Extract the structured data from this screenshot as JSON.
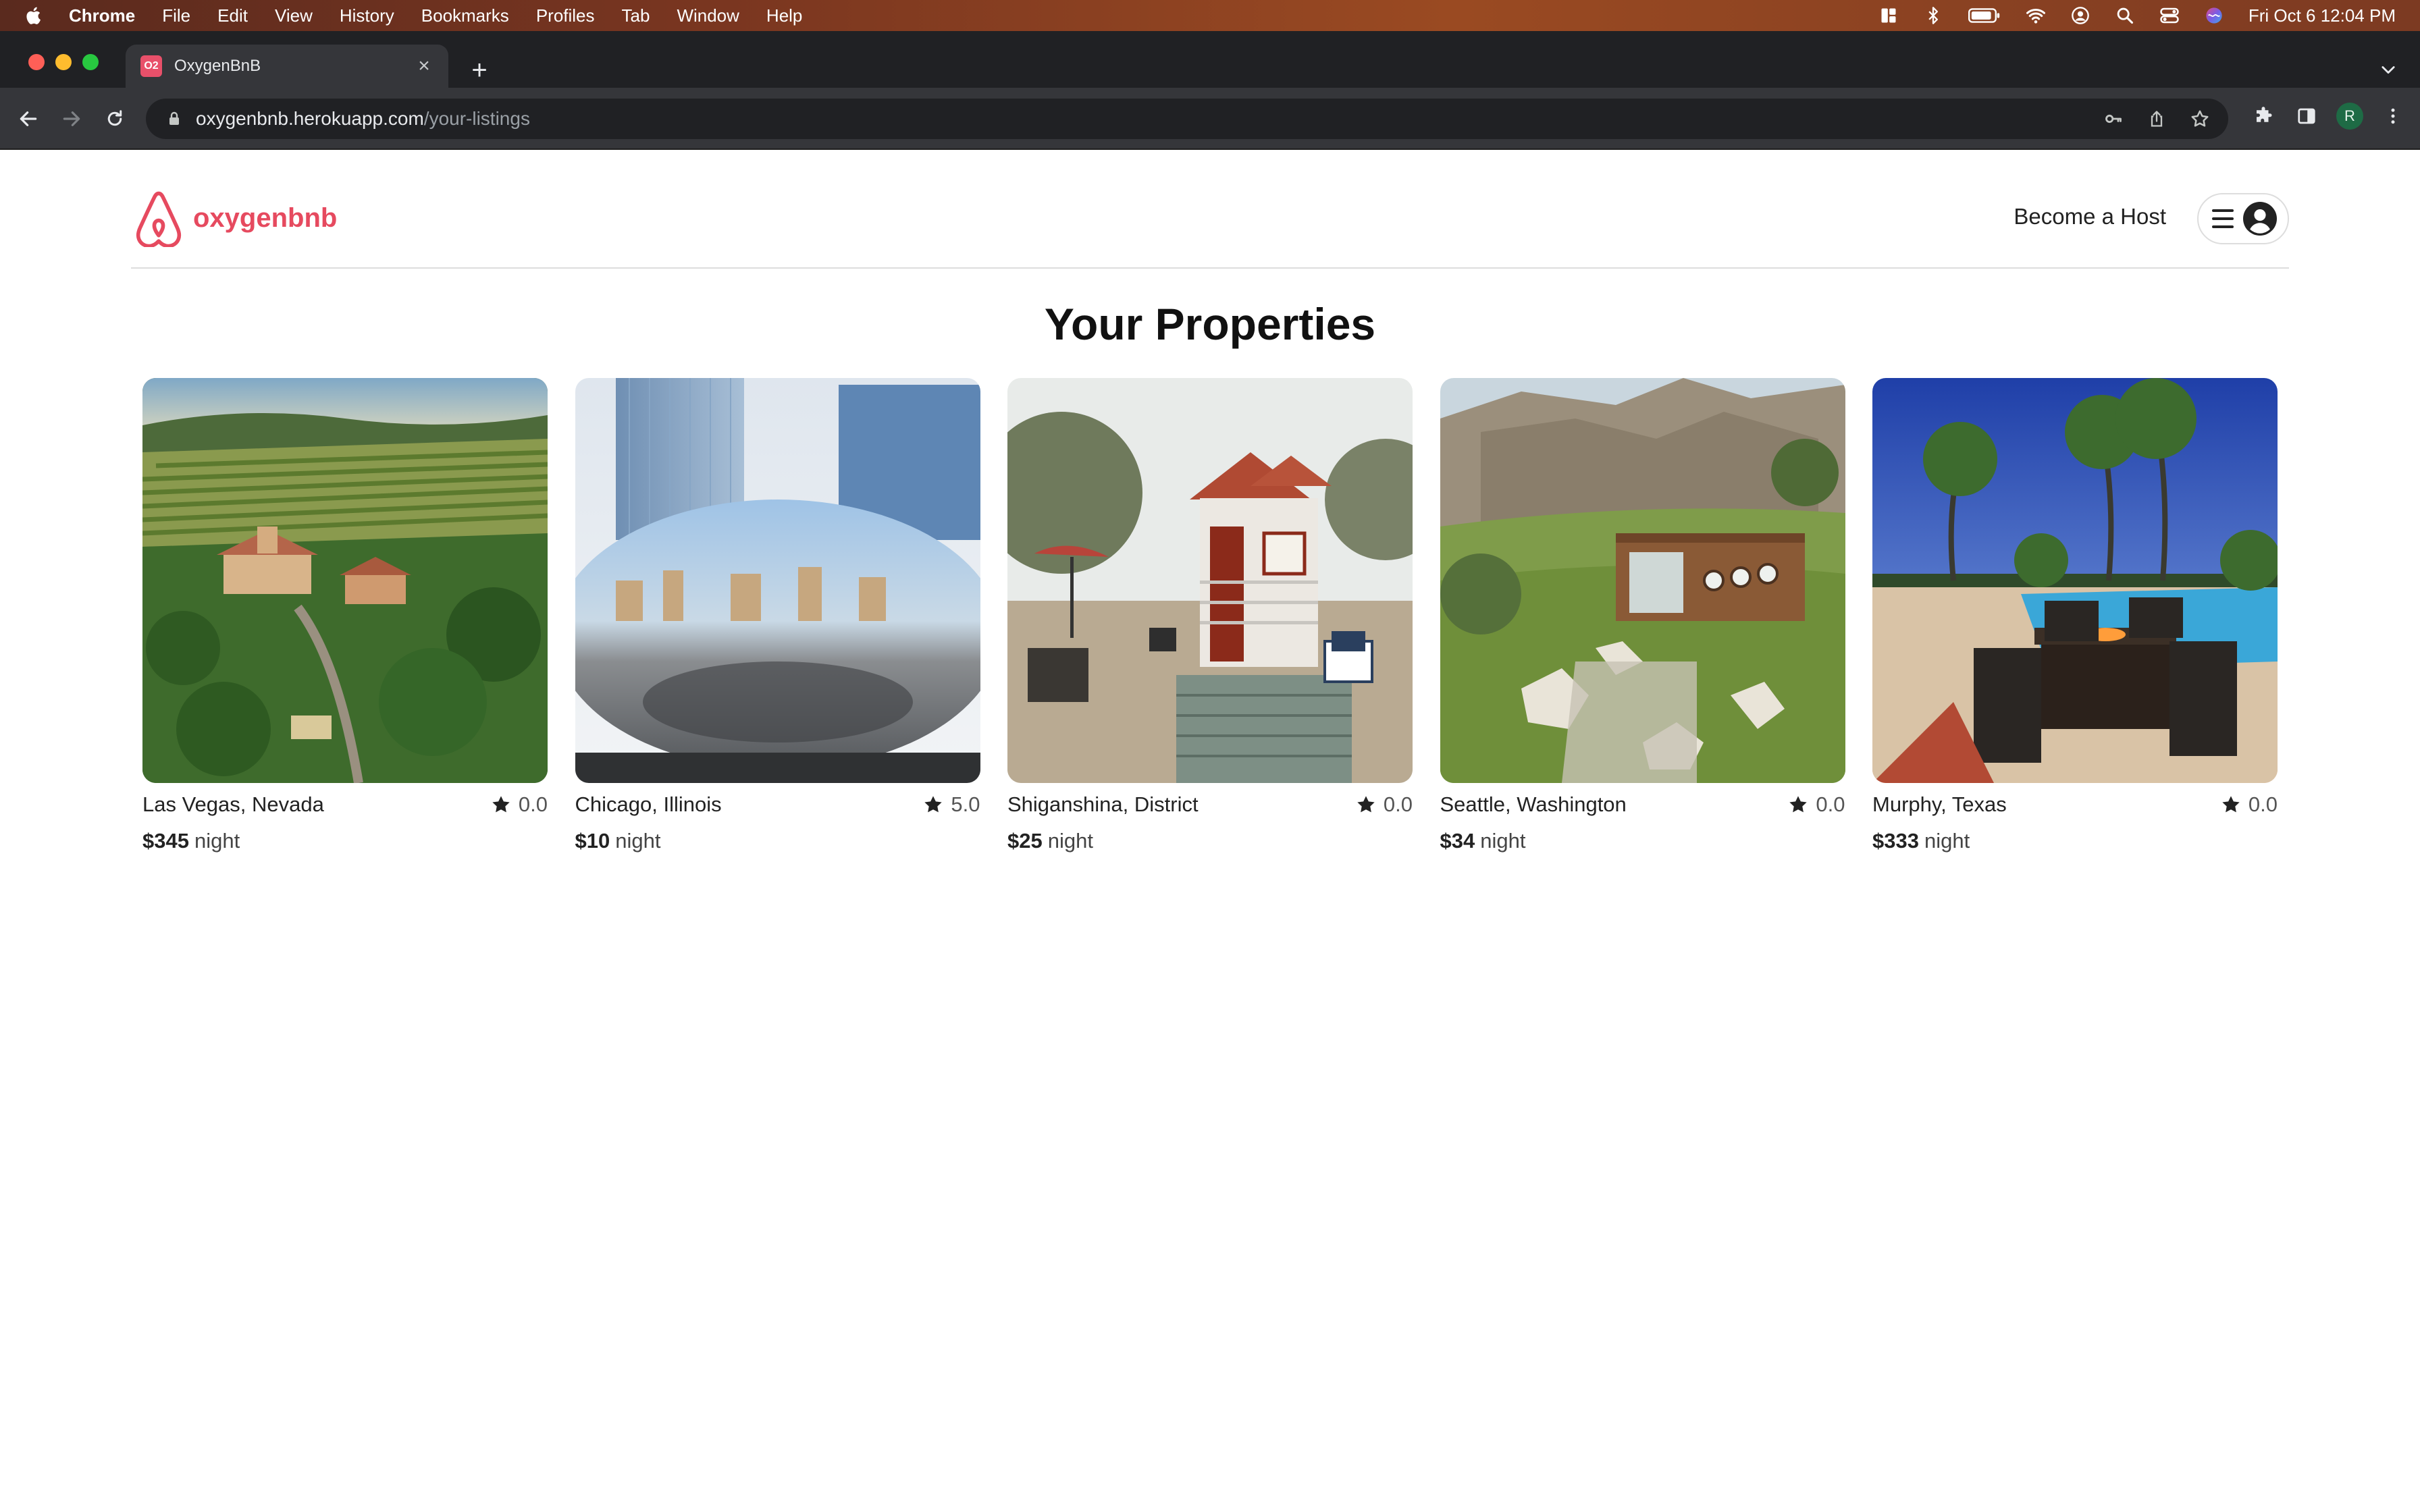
{
  "menubar": {
    "app_name": "Chrome",
    "menus": [
      "File",
      "Edit",
      "View",
      "History",
      "Bookmarks",
      "Profiles",
      "Tab",
      "Window",
      "Help"
    ],
    "clock": "Fri Oct 6  12:04 PM"
  },
  "browser": {
    "tab": {
      "favicon_text": "O2",
      "title": "OxygenBnB",
      "close": "×"
    },
    "new_tab": "+",
    "url_host": "oxygenbnb.herokuapp.com",
    "url_path": "/your-listings",
    "profile_initial": "R"
  },
  "site": {
    "brand": "oxygenbnb",
    "brand_color": "#e64a5f",
    "become_host": "Become a Host"
  },
  "page_title": "Your Properties",
  "price_unit": "night",
  "listings": [
    {
      "location": "Las Vegas, Nevada",
      "rating": "0.0",
      "price": "$345",
      "photo": "tuscan-villa-vineyard"
    },
    {
      "location": "Chicago, Illinois",
      "rating": "5.0",
      "price": "$10",
      "photo": "cloud-gate-bean"
    },
    {
      "location": "Shiganshina, District",
      "rating": "0.0",
      "price": "$25",
      "photo": "tiny-house-patio"
    },
    {
      "location": "Seattle, Washington",
      "rating": "0.0",
      "price": "$34",
      "photo": "hillside-pod-cabin"
    },
    {
      "location": "Murphy, Texas",
      "rating": "0.0",
      "price": "$333",
      "photo": "poolside-fire-table"
    }
  ]
}
